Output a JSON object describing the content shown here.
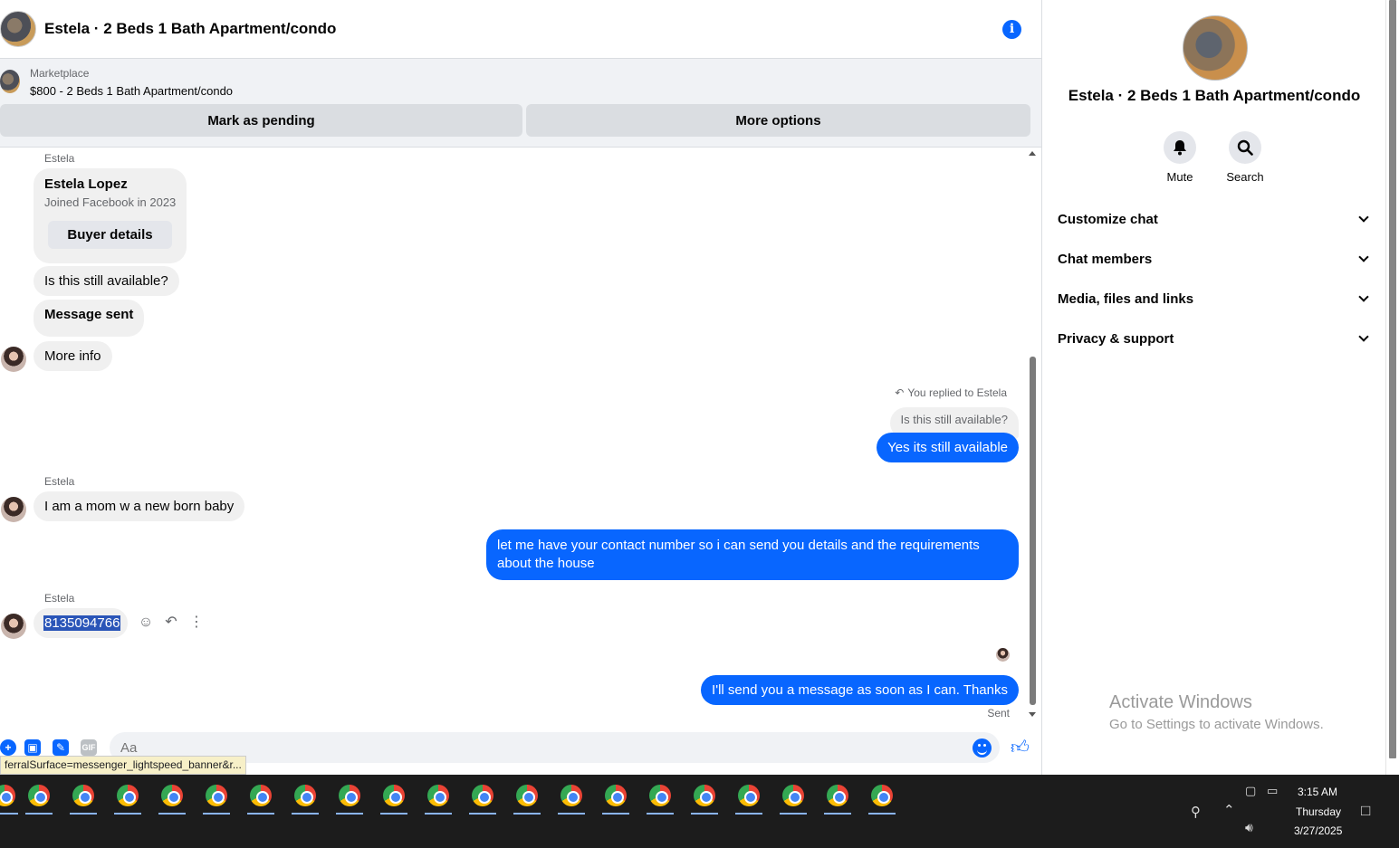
{
  "header": {
    "title": "Estela · 2 Beds 1 Bath Apartment/condo"
  },
  "marketplace": {
    "label": "Marketplace",
    "listing": "$800 - 2 Beds 1 Bath Apartment/condo",
    "mark_pending": "Mark as pending",
    "more_options": "More options"
  },
  "messages": {
    "sender_1": "Estela",
    "buyer_card": {
      "name": "Estela Lopez",
      "joined": "Joined Facebook in 2023",
      "button": "Buyer details"
    },
    "in_1": "Is this still available?",
    "in_2": "Message sent",
    "in_3": "More info",
    "reply_note": "You replied to Estela",
    "reply_quote": "Is this still available?",
    "out_1": "Yes its still available",
    "sender_2": "Estela",
    "in_4": "I am a mom w a new born baby",
    "out_2": "let me have your contact number so i can send you details and the requirements about the house",
    "sender_3": "Estela",
    "in_5": "8135094766",
    "out_3": "I'll send you a message as soon as I can. Thanks",
    "status": "Sent"
  },
  "composer": {
    "placeholder": "Aa",
    "gif_label": "GIF"
  },
  "tooltip_url": "ferralSurface=messenger_lightspeed_banner&r...",
  "side_panel": {
    "title": "Estela · 2 Beds 1 Bath Apartment/condo",
    "mute": "Mute",
    "search": "Search",
    "rows": [
      "Customize chat",
      "Chat members",
      "Media, files and links",
      "Privacy & support"
    ]
  },
  "watermark": {
    "line1": "Activate Windows",
    "line2": "Go to Settings to activate Windows."
  },
  "taskbar": {
    "time": "3:15 AM",
    "day": "Thursday",
    "date": "3/27/2025"
  },
  "colors": {
    "accent": "#0866ff",
    "bubble_in": "#f0f0f0",
    "taskbar": "#1c1c1c"
  }
}
